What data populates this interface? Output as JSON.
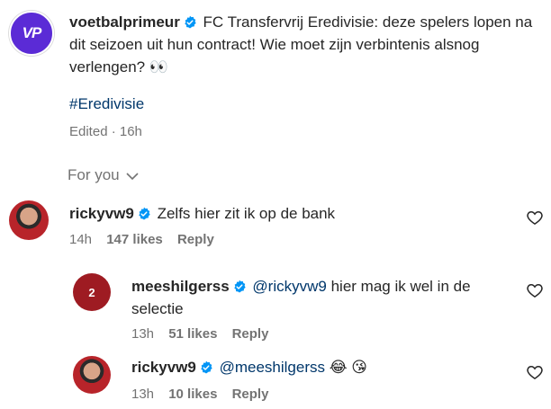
{
  "post": {
    "avatar_text": "VP",
    "username": "voetbalprimeur",
    "caption": "FC Transfervrij Eredivisie: deze spelers lopen na dit seizoen uit hun contract! Wie moet zijn verbintenis alsnog verlengen? 👀",
    "hashtag": "#Eredivisie",
    "meta": "Edited · 16h"
  },
  "filter_label": "For you",
  "comments": [
    {
      "username": "rickyvw9",
      "text": "Zelfs hier zit ik op de bank",
      "time": "14h",
      "likes": "147 likes",
      "reply_label": "Reply"
    },
    {
      "username": "meeshilgerss",
      "mention": "@rickyvw9",
      "text": " hier mag ik wel in de selectie",
      "time": "13h",
      "likes": "51 likes",
      "reply_label": "Reply",
      "avatar_number": "2"
    },
    {
      "username": "rickyvw9",
      "mention": "@meeshilgerss",
      "text": " 😂 😘",
      "time": "13h",
      "likes": "10 likes",
      "reply_label": "Reply"
    }
  ],
  "colors": {
    "verified": "#0095f6",
    "mention": "#00376b",
    "meta": "#737373"
  }
}
